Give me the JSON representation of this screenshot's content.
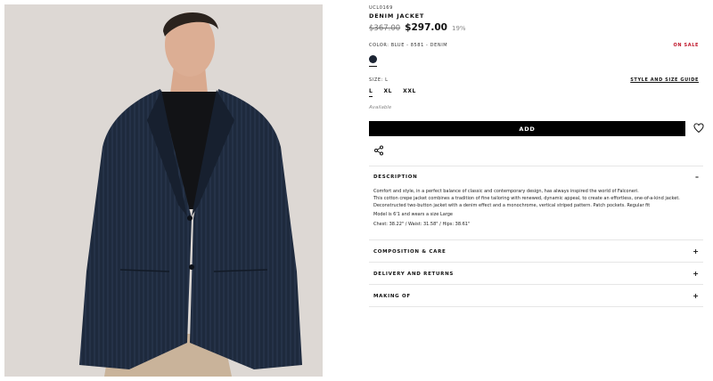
{
  "product": {
    "sku": "UCL0169",
    "title": "DENIM JACKET",
    "old_price": "$367.00",
    "new_price": "$297.00",
    "discount": "19%"
  },
  "color": {
    "label": "COLOR: BLUE - 8581 - DENIM",
    "sale_badge": "ON SALE",
    "swatch_hex": "#1c2433"
  },
  "size": {
    "label": "SIZE: L",
    "guide_link": "STYLE AND SIZE GUIDE",
    "options": [
      "L",
      "XL",
      "XXL"
    ],
    "selected": "L"
  },
  "availability": "Available",
  "actions": {
    "add_label": "ADD",
    "wishlist_icon": "heart-icon",
    "share_icon": "share-icon"
  },
  "accordion": {
    "description": {
      "title": "DESCRIPTION",
      "sign": "–",
      "para1": "Comfort and style, in a perfect balance of classic and contemporary design, has always inspired the world of Falconeri.",
      "para2": "This cotton crepe jacket combines a tradition of fine tailoring with renewed, dynamic appeal, to create an effortless, one-of-a-kind jacket. Deconstructed two-button jacket with a denim effect and a monochrome, vertical striped pattern. Patch pockets. Regular fit",
      "model": "Model is 6'1 and wears a size Large",
      "measurements": "Chest: 38.22\" / Waist: 31.58\" / Hips: 38.61\""
    },
    "composition": {
      "title": "COMPOSITION & CARE",
      "sign": "+"
    },
    "delivery": {
      "title": "DELIVERY AND RETURNS",
      "sign": "+"
    },
    "making": {
      "title": "MAKING OF",
      "sign": "+"
    }
  },
  "colors": {
    "accent": "#000000",
    "sale": "#c0162a",
    "photo_bg": "#ddd8d4"
  }
}
